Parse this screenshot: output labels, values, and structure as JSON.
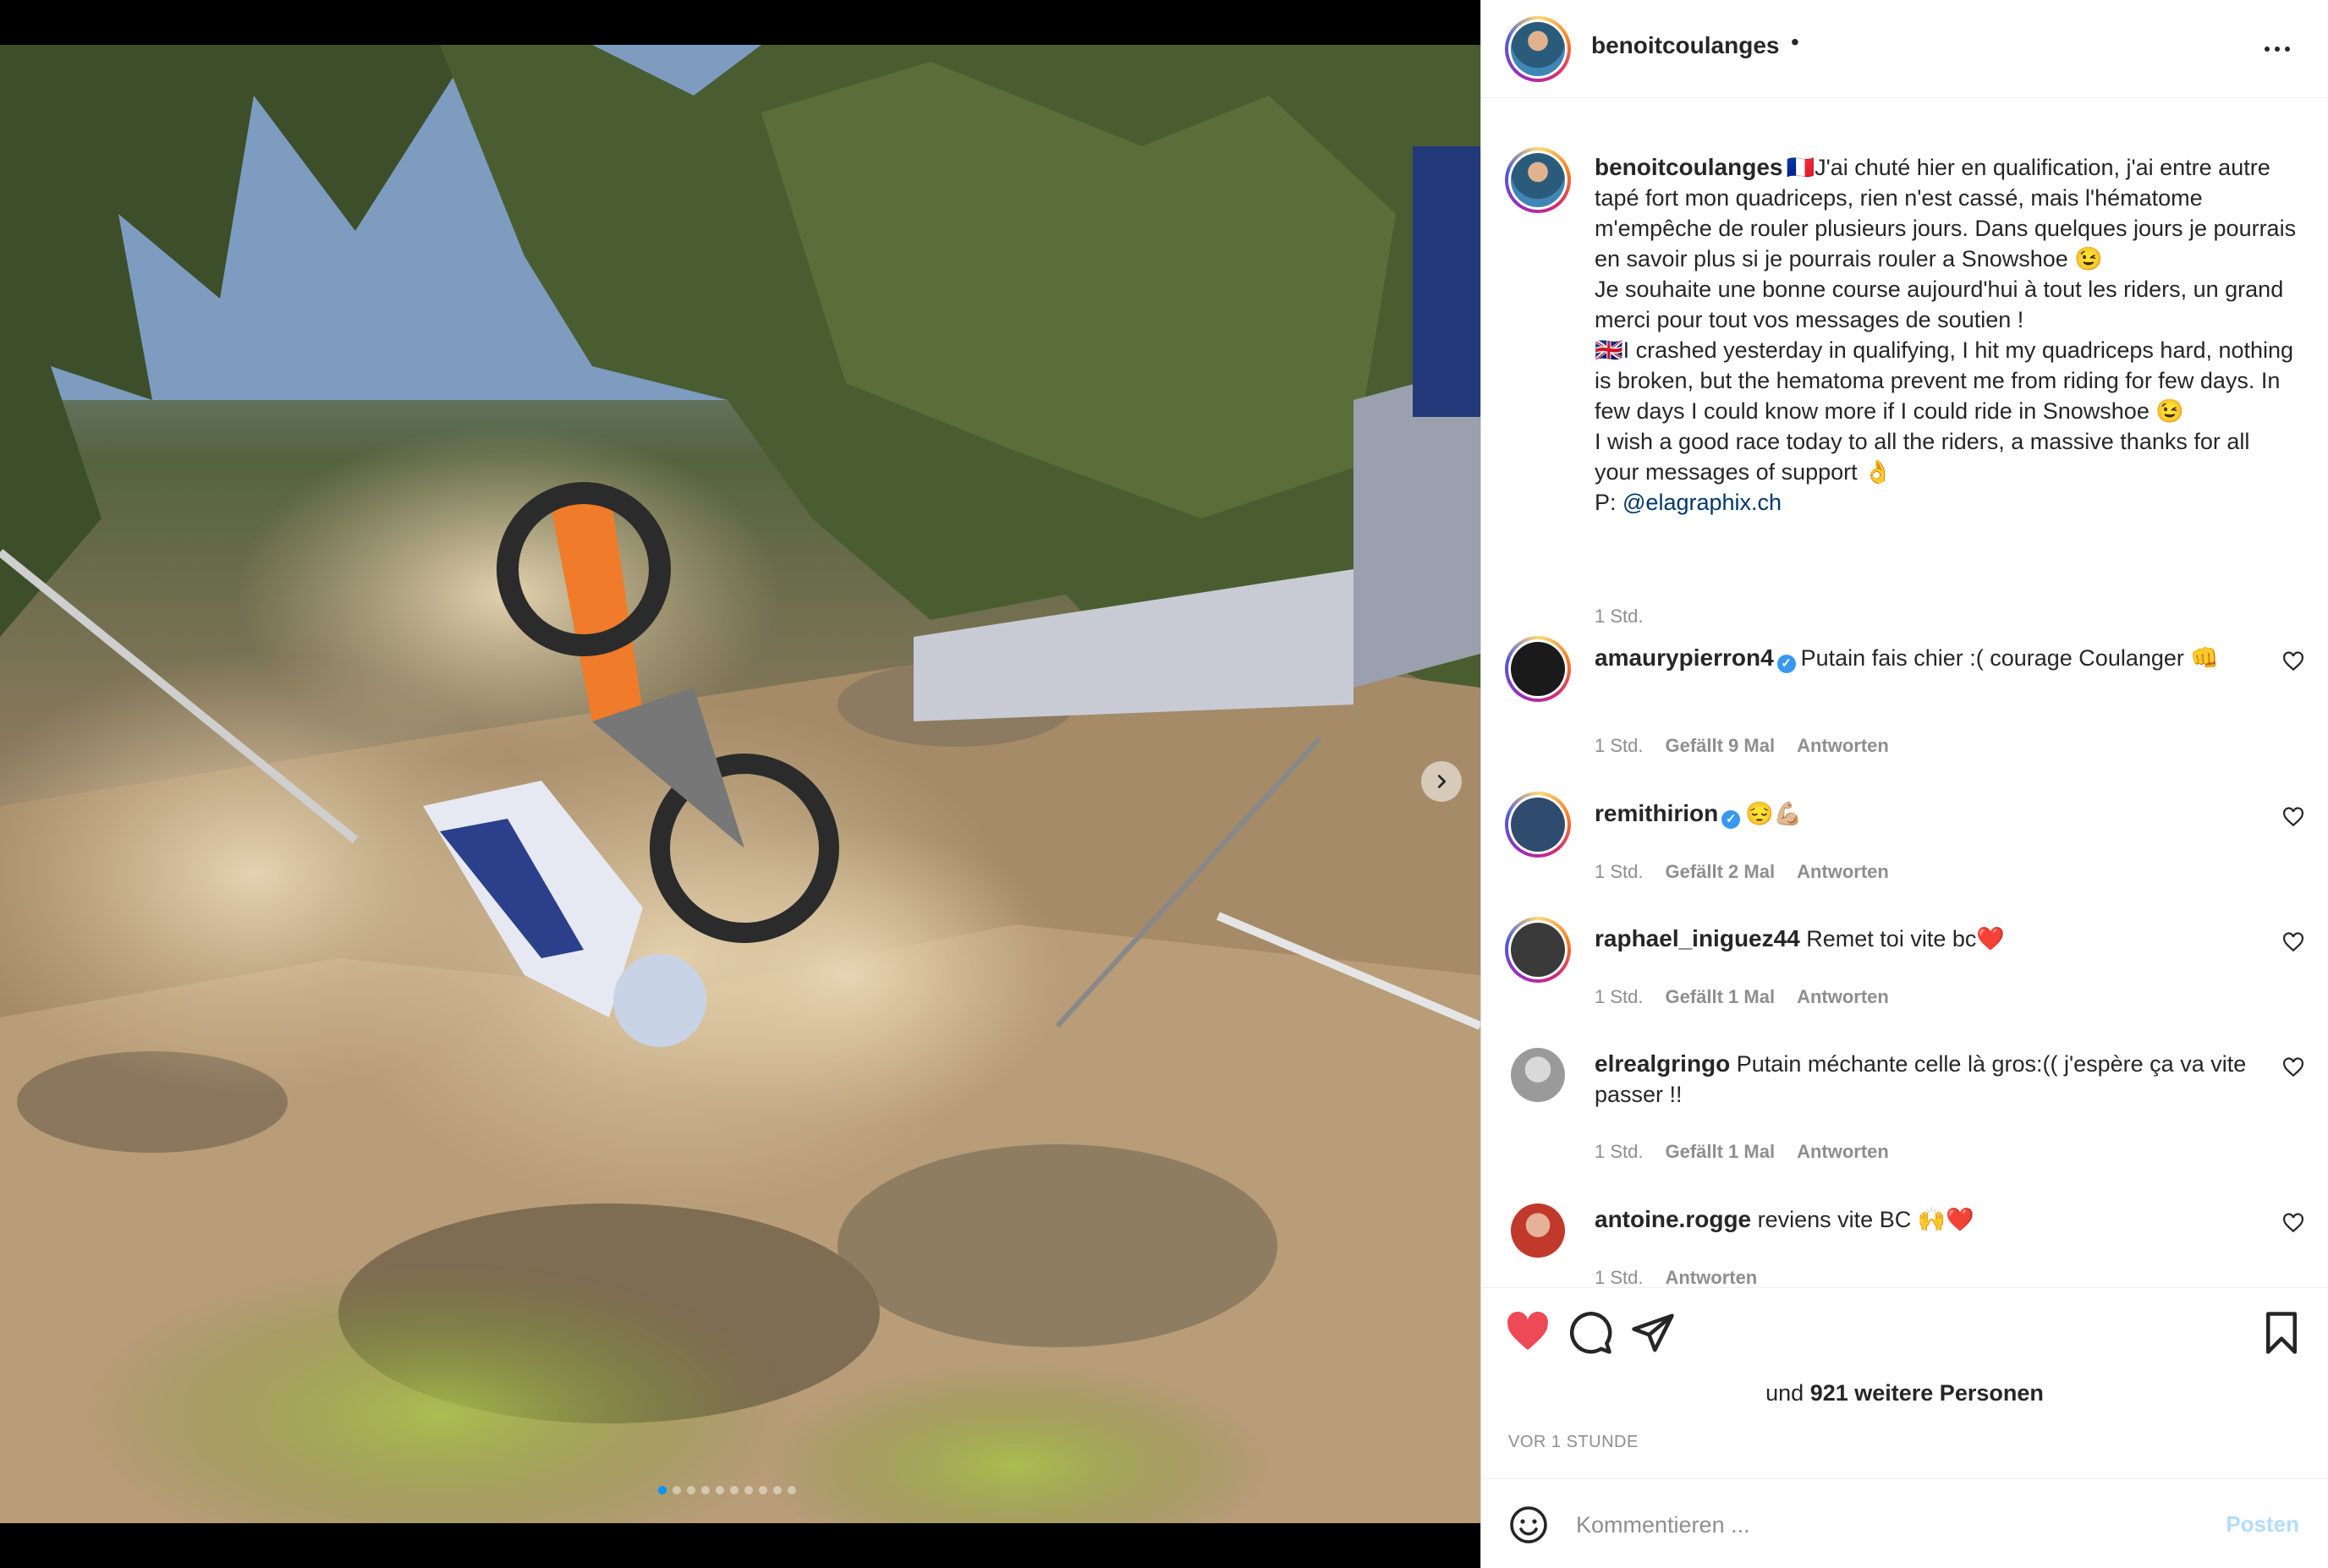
{
  "post": {
    "username": "benoitcoulanges",
    "header_separator": "•",
    "more_icon": "more-horizontal-icon",
    "caption_lines": [
      "🇫🇷J'ai chuté hier en qualification, j'ai entre autre tapé fort mon quadriceps, rien n'est cassé, mais l'hématome m'empêche de rouler plusieurs jours. Dans quelques jours je pourrais en savoir plus si je pourrais rouler a Snowshoe 😉",
      "Je souhaite une bonne course aujourd'hui à tout les riders, un grand merci pour tout vos messages de soutien !",
      "🇬🇧I crashed yesterday in qualifying, I hit my quadriceps hard, nothing is broken, but the hematoma prevent me from riding for few days. In few days I could know more if I could ride in Snowshoe 😉",
      "I wish a good race today to all the riders, a massive thanks for all your messages of support 👌"
    ],
    "credit_prefix": "P: ",
    "credit_mention": "@elagraphix.ch",
    "caption_time": "1 Std.",
    "carousel": {
      "slide_count": 10,
      "active_index": 0,
      "accent": "#0095f6"
    }
  },
  "comments": [
    {
      "username": "amaurypierron4",
      "verified": true,
      "text": "Putain fais chier :( courage Coulanger 👊",
      "time": "1 Std.",
      "likes": "Gefällt 9 Mal",
      "reply": "Antworten",
      "avatar_color": "#1a1a1a"
    },
    {
      "username": "remithirion",
      "verified": true,
      "text": "😔💪🏼",
      "time": "1 Std.",
      "likes": "Gefällt 2 Mal",
      "reply": "Antworten",
      "avatar_color": "#2f4b6e"
    },
    {
      "username": "raphael_iniguez44",
      "verified": false,
      "text": "Remet toi vite bc❤️",
      "time": "1 Std.",
      "likes": "Gefällt 1 Mal",
      "reply": "Antworten",
      "avatar_color": "#3a3a3a"
    },
    {
      "username": "elrealgringo",
      "verified": false,
      "text": "Putain méchante celle là gros:(( j'espère ça va vite passer !!",
      "time": "1 Std.",
      "likes": "Gefällt 1 Mal",
      "reply": "Antworten",
      "avatar_color": "#9a9a9a"
    },
    {
      "username": "antoine.rogge",
      "verified": false,
      "text": "reviens vite BC 🙌❤️",
      "time": "1 Std.",
      "likes": "",
      "reply": "Antworten",
      "avatar_color": "#c0392b"
    }
  ],
  "actions": {
    "like_icon": "heart-filled-icon",
    "comment_icon": "comment-bubble-icon",
    "share_icon": "paper-plane-icon",
    "save_icon": "bookmark-icon",
    "like_color": "#ed4956"
  },
  "likes_summary": {
    "prefix": "und ",
    "count": "921 weitere Personen"
  },
  "timestamp": "VOR 1 STUNDE",
  "composer": {
    "placeholder": "Kommentieren ...",
    "post_label": "Posten",
    "emoji_icon": "smiley-icon"
  }
}
